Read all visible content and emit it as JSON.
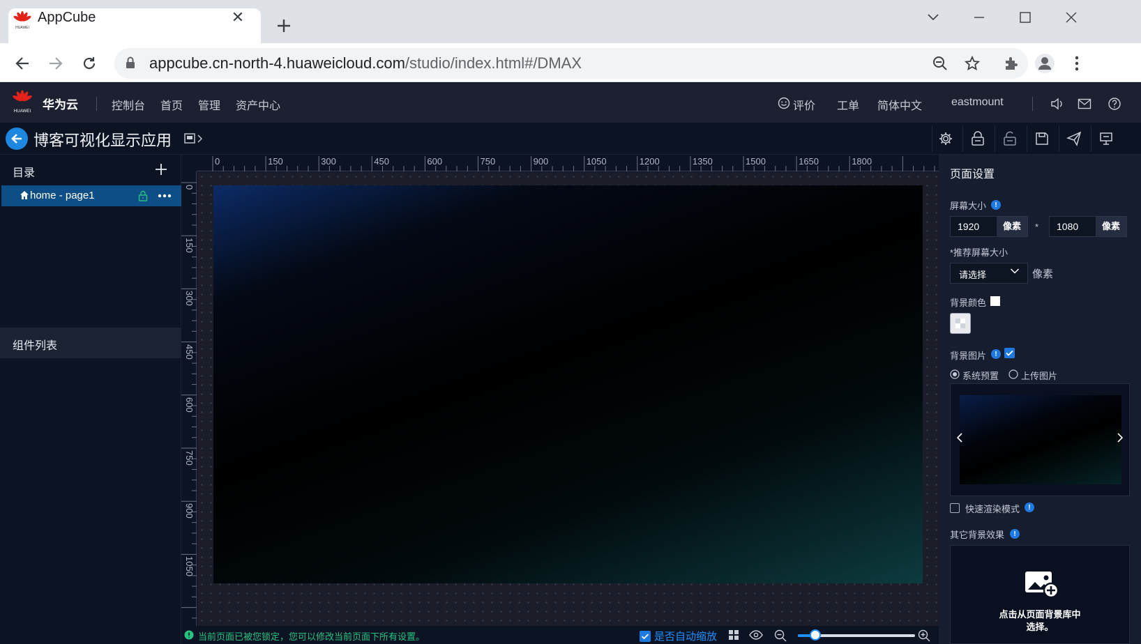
{
  "browser": {
    "tab_title": "AppCube",
    "url_host": "appcube.cn-north-4.huaweicloud.com",
    "url_path": "/studio/index.html#/DMAX"
  },
  "header": {
    "brand": "华为云",
    "logo_text": "HUAWEI",
    "nav": [
      "控制台",
      "首页",
      "管理",
      "资产中心"
    ],
    "feedback": "评价",
    "ticket": "工单",
    "language": "简体中文",
    "user": "eastmount"
  },
  "studio": {
    "app_title": "博客可视化显示应用"
  },
  "left": {
    "directory_title": "目录",
    "page_item": "home - page1",
    "components_title": "组件列表"
  },
  "rulers": {
    "h_ticks": [
      "0",
      "150",
      "300",
      "450",
      "600",
      "750",
      "900",
      "1050",
      "1200",
      "1350",
      "1500",
      "1650",
      "1800"
    ],
    "v_ticks": [
      "0",
      "150",
      "300",
      "450",
      "600",
      "750",
      "900",
      "1050"
    ]
  },
  "status": {
    "lock_message": "当前页面已被您锁定，您可以修改当前页面下所有设置。",
    "auto_zoom": "是否自动缩放",
    "zoom_fraction": 0.15
  },
  "right": {
    "title": "页面设置",
    "screen_size_label": "屏幕大小",
    "width": "1920",
    "height": "1080",
    "unit": "像素",
    "times": "*",
    "recommended_label": "*推荐屏幕大小",
    "recommended_placeholder": "请选择",
    "recommended_unit": "像素",
    "bg_color_label": "背景颜色",
    "bg_image_label": "背景图片",
    "bg_image_checked": true,
    "radio_system": "系统预置",
    "radio_upload": "上传图片",
    "fast_render": "快速渲染模式",
    "other_effects": "其它背景效果",
    "bg_library_line1": "点击从页面背景库中",
    "bg_library_line2": "选择。"
  },
  "colors": {
    "accent": "#1e7ae0",
    "header_bg": "#1c2030",
    "panel_bg": "#0c1424",
    "selected_item": "#0e4e87",
    "lock_green": "#27c27f"
  }
}
